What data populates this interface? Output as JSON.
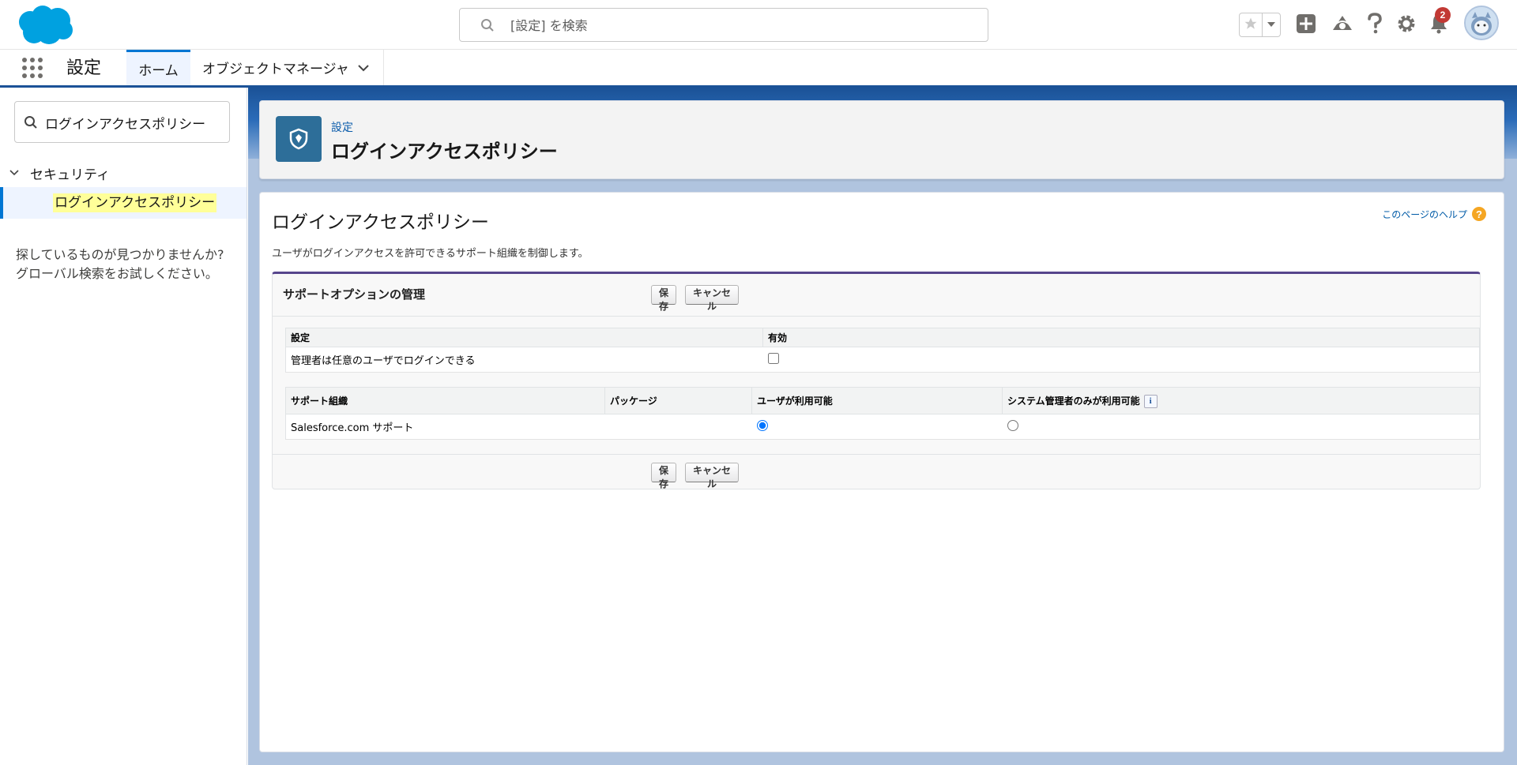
{
  "header": {
    "search_placeholder": "[設定] を検索",
    "notification_count": "2",
    "icons": [
      "cloud-logo",
      "search-icon",
      "star-icon",
      "chevron-down-icon",
      "plus-icon",
      "trailhead-icon",
      "help-icon",
      "gear-icon",
      "bell-icon",
      "avatar"
    ]
  },
  "context_bar": {
    "app_name": "設定",
    "tabs": [
      {
        "label": "ホーム",
        "active": true
      },
      {
        "label": "オブジェクトマネージャ",
        "active": false
      }
    ]
  },
  "sidebar": {
    "quickfind_value": "ログインアクセスポリシー",
    "section": "セキュリティ",
    "item": "ログインアクセスポリシー",
    "no_results_line1": "探しているものが見つかりませんか?",
    "no_results_line2": "グローバル検索をお試しください。"
  },
  "page_header": {
    "breadcrumb": "設定",
    "title": "ログインアクセスポリシー"
  },
  "content": {
    "title": "ログインアクセスポリシー",
    "help_link": "このページのヘルプ",
    "description": "ユーザがログインアクセスを許可できるサポート組織を制御します。",
    "block_title": "サポートオプションの管理",
    "save_label": "保存",
    "cancel_label": "キャンセル",
    "settings_table": {
      "headers": [
        "設定",
        "有効"
      ],
      "rows": [
        {
          "setting": "管理者は任意のユーザでログインできる",
          "enabled": false
        }
      ]
    },
    "support_table": {
      "headers": [
        "サポート組織",
        "パッケージ",
        "ユーザが利用可能",
        "システム管理者のみが利用可能"
      ],
      "rows": [
        {
          "org": "Salesforce.com サポート",
          "package": "",
          "user_available": true,
          "admin_only": false
        }
      ]
    }
  },
  "colors": {
    "brand_blue": "#0176d3",
    "header_band": "#1b5297",
    "page_icon_bg": "#2d6e99",
    "highlight": "#ffff99",
    "badge_red": "#c23934"
  }
}
